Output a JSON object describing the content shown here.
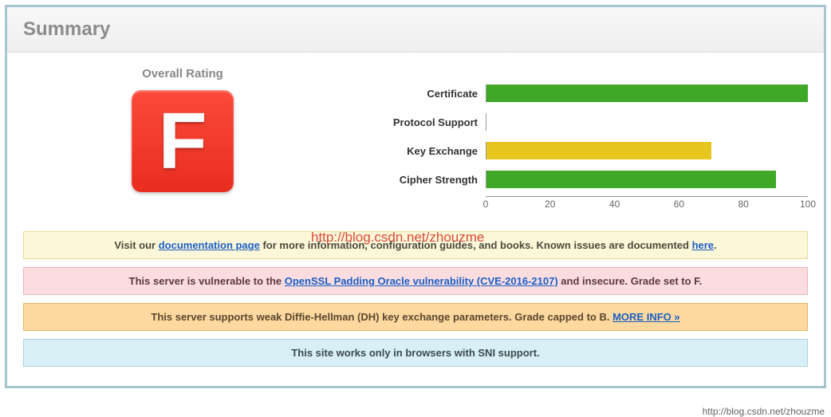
{
  "header": {
    "title": "Summary"
  },
  "rating": {
    "label": "Overall Rating",
    "grade": "F"
  },
  "chart_data": {
    "type": "bar",
    "categories": [
      "Certificate",
      "Protocol Support",
      "Key Exchange",
      "Cipher Strength"
    ],
    "values": [
      100,
      0,
      70,
      90
    ],
    "colors": [
      "#3fa927",
      "#3fa927",
      "#e7c51f",
      "#3fa927"
    ],
    "title": "",
    "xlabel": "",
    "ylabel": "",
    "ylim": [
      0,
      100
    ],
    "ticks": [
      0,
      20,
      40,
      60,
      80,
      100
    ]
  },
  "watermark_center": "http://blog.csdn.net/zhouzme",
  "notices": [
    {
      "style": "n-yellow",
      "parts": [
        {
          "text": "Visit our "
        },
        {
          "text": "documentation page",
          "link": true,
          "name": "documentation-link"
        },
        {
          "text": " for more information, configuration guides, and books. Known issues are documented "
        },
        {
          "text": "here",
          "link": true,
          "name": "known-issues-link"
        },
        {
          "text": "."
        }
      ]
    },
    {
      "style": "n-pink",
      "parts": [
        {
          "text": "This server is vulnerable to the "
        },
        {
          "text": "OpenSSL Padding Oracle vulnerability (CVE-2016-2107)",
          "link": true,
          "name": "cve-link"
        },
        {
          "text": " and insecure. Grade set to F."
        }
      ]
    },
    {
      "style": "n-orange",
      "parts": [
        {
          "text": "This server supports weak Diffie-Hellman (DH) key exchange parameters. Grade capped to B.   "
        },
        {
          "text": "MORE INFO »",
          "link": true,
          "name": "more-info-link"
        }
      ]
    },
    {
      "style": "n-blue",
      "parts": [
        {
          "text": "This site works only in browsers with SNI support."
        }
      ]
    }
  ],
  "footer_watermark": "http://blog.csdn.net/zhouzme"
}
